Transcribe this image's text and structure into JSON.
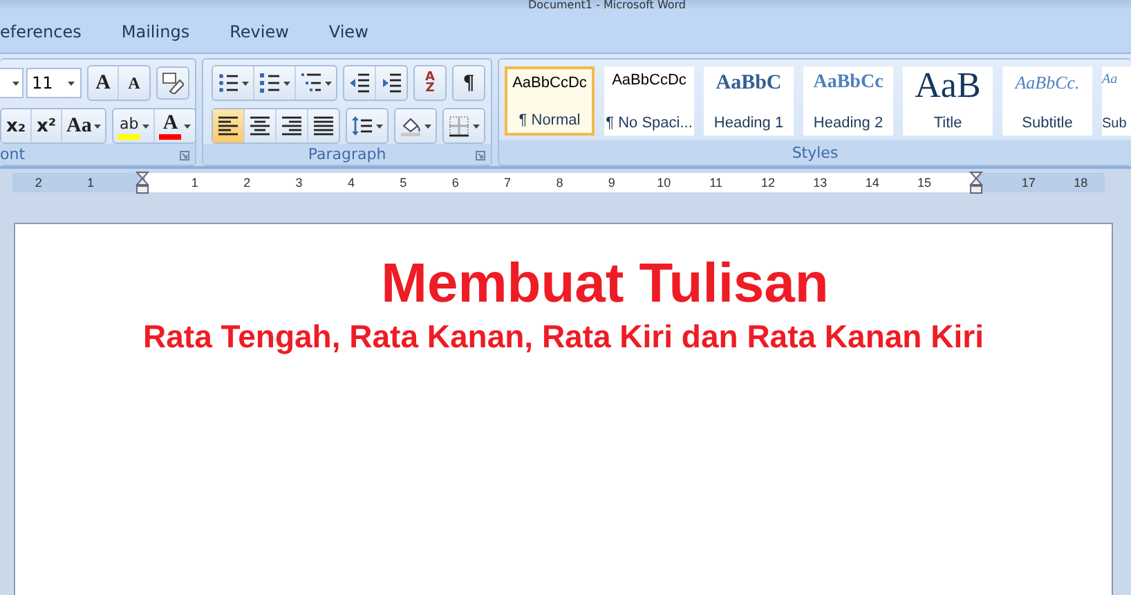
{
  "window": {
    "title": "Document1 - Microsoft Word"
  },
  "tabs": [
    {
      "label": "eferences",
      "selected": false
    },
    {
      "label": "Mailings",
      "selected": false
    },
    {
      "label": "Review",
      "selected": false
    },
    {
      "label": "View",
      "selected": false
    }
  ],
  "font_group": {
    "label": "ont",
    "size": "11",
    "row1": [
      {
        "kind": "grow",
        "text": "A"
      },
      {
        "kind": "shrink",
        "text": "A"
      },
      {
        "kind": "clear"
      }
    ],
    "row2": [
      {
        "kind": "subscript",
        "text": "x₂"
      },
      {
        "kind": "superscript",
        "text": "x²"
      },
      {
        "kind": "case",
        "text": "Aa",
        "has_menu": true
      },
      {
        "kind": "highlight",
        "text": "ab",
        "has_menu": true,
        "color": "#ffff00"
      },
      {
        "kind": "fontcolor",
        "text": "A",
        "has_menu": true,
        "color": "#ff0000"
      }
    ]
  },
  "paragraph_group": {
    "label": "Paragraph",
    "row1": [
      {
        "kind": "bullets",
        "has_menu": true,
        "selected": false
      },
      {
        "kind": "numbering",
        "has_menu": true,
        "selected": false
      },
      {
        "kind": "multilevel",
        "has_menu": true,
        "selected": false
      },
      {
        "kind": "outdent",
        "selected": false
      },
      {
        "kind": "indent",
        "selected": false
      },
      {
        "kind": "sort",
        "text": "AZ",
        "selected": false
      },
      {
        "kind": "pilcrow",
        "text": "¶",
        "selected": false
      }
    ],
    "row2": [
      {
        "kind": "align-left",
        "selected": true
      },
      {
        "kind": "align-center",
        "selected": false
      },
      {
        "kind": "align-right",
        "selected": false
      },
      {
        "kind": "justify",
        "selected": false
      },
      {
        "kind": "line-spacing",
        "has_menu": true,
        "selected": false
      },
      {
        "kind": "shading",
        "has_menu": true,
        "selected": false
      },
      {
        "kind": "borders",
        "has_menu": true,
        "selected": false
      }
    ]
  },
  "styles_group": {
    "label": "Styles",
    "items": [
      {
        "kind": "normal",
        "preview": "AaBbCcDc",
        "name": "¶ Normal",
        "selected": true
      },
      {
        "kind": "normal",
        "preview": "AaBbCcDc",
        "name": "¶ No Spaci...",
        "selected": false
      },
      {
        "kind": "heading1",
        "preview": "AaBbC",
        "name": "Heading 1",
        "selected": false
      },
      {
        "kind": "heading2",
        "preview": "AaBbCc",
        "name": "Heading 2",
        "selected": false
      },
      {
        "kind": "title",
        "preview": "AaB",
        "name": "Title",
        "selected": false
      },
      {
        "kind": "subtitle",
        "preview": "AaBbCc.",
        "name": "Subtitle",
        "selected": false
      },
      {
        "kind": "subtitle",
        "preview": "Aa",
        "name": "Sub",
        "selected": false
      }
    ]
  },
  "ruler": [
    {
      "kind": "number",
      "text": "2"
    },
    {
      "kind": "number",
      "text": "1"
    },
    {
      "kind": "marker"
    },
    {
      "kind": "number",
      "text": "1"
    },
    {
      "kind": "number",
      "text": "2"
    },
    {
      "kind": "number",
      "text": "3"
    },
    {
      "kind": "number",
      "text": "4"
    },
    {
      "kind": "number",
      "text": "5"
    },
    {
      "kind": "number",
      "text": "6"
    },
    {
      "kind": "number",
      "text": "7"
    },
    {
      "kind": "number",
      "text": "8"
    },
    {
      "kind": "number",
      "text": "9"
    },
    {
      "kind": "number",
      "text": "10"
    },
    {
      "kind": "number",
      "text": "11"
    },
    {
      "kind": "number",
      "text": "12"
    },
    {
      "kind": "number",
      "text": "13"
    },
    {
      "kind": "number",
      "text": "14"
    },
    {
      "kind": "number",
      "text": "15"
    },
    {
      "kind": "marker"
    },
    {
      "kind": "number",
      "text": "17"
    },
    {
      "kind": "number",
      "text": "18"
    }
  ],
  "document": {
    "paragraphs": [
      {
        "kind": "heading",
        "text": "Membuat Tulisan"
      },
      {
        "kind": "subheading",
        "text": "Rata Tengah, Rata Kanan, Rata Kiri dan Rata Kanan Kiri"
      }
    ]
  }
}
